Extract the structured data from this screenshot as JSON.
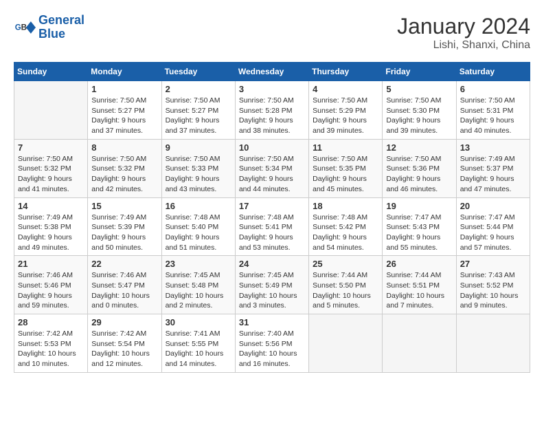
{
  "header": {
    "logo_line1": "General",
    "logo_line2": "Blue",
    "month": "January 2024",
    "location": "Lishi, Shanxi, China"
  },
  "weekdays": [
    "Sunday",
    "Monday",
    "Tuesday",
    "Wednesday",
    "Thursday",
    "Friday",
    "Saturday"
  ],
  "weeks": [
    [
      {
        "num": "",
        "info": ""
      },
      {
        "num": "1",
        "info": "Sunrise: 7:50 AM\nSunset: 5:27 PM\nDaylight: 9 hours\nand 37 minutes."
      },
      {
        "num": "2",
        "info": "Sunrise: 7:50 AM\nSunset: 5:27 PM\nDaylight: 9 hours\nand 37 minutes."
      },
      {
        "num": "3",
        "info": "Sunrise: 7:50 AM\nSunset: 5:28 PM\nDaylight: 9 hours\nand 38 minutes."
      },
      {
        "num": "4",
        "info": "Sunrise: 7:50 AM\nSunset: 5:29 PM\nDaylight: 9 hours\nand 39 minutes."
      },
      {
        "num": "5",
        "info": "Sunrise: 7:50 AM\nSunset: 5:30 PM\nDaylight: 9 hours\nand 39 minutes."
      },
      {
        "num": "6",
        "info": "Sunrise: 7:50 AM\nSunset: 5:31 PM\nDaylight: 9 hours\nand 40 minutes."
      }
    ],
    [
      {
        "num": "7",
        "info": "Sunrise: 7:50 AM\nSunset: 5:32 PM\nDaylight: 9 hours\nand 41 minutes."
      },
      {
        "num": "8",
        "info": "Sunrise: 7:50 AM\nSunset: 5:32 PM\nDaylight: 9 hours\nand 42 minutes."
      },
      {
        "num": "9",
        "info": "Sunrise: 7:50 AM\nSunset: 5:33 PM\nDaylight: 9 hours\nand 43 minutes."
      },
      {
        "num": "10",
        "info": "Sunrise: 7:50 AM\nSunset: 5:34 PM\nDaylight: 9 hours\nand 44 minutes."
      },
      {
        "num": "11",
        "info": "Sunrise: 7:50 AM\nSunset: 5:35 PM\nDaylight: 9 hours\nand 45 minutes."
      },
      {
        "num": "12",
        "info": "Sunrise: 7:50 AM\nSunset: 5:36 PM\nDaylight: 9 hours\nand 46 minutes."
      },
      {
        "num": "13",
        "info": "Sunrise: 7:49 AM\nSunset: 5:37 PM\nDaylight: 9 hours\nand 47 minutes."
      }
    ],
    [
      {
        "num": "14",
        "info": "Sunrise: 7:49 AM\nSunset: 5:38 PM\nDaylight: 9 hours\nand 49 minutes."
      },
      {
        "num": "15",
        "info": "Sunrise: 7:49 AM\nSunset: 5:39 PM\nDaylight: 9 hours\nand 50 minutes."
      },
      {
        "num": "16",
        "info": "Sunrise: 7:48 AM\nSunset: 5:40 PM\nDaylight: 9 hours\nand 51 minutes."
      },
      {
        "num": "17",
        "info": "Sunrise: 7:48 AM\nSunset: 5:41 PM\nDaylight: 9 hours\nand 53 minutes."
      },
      {
        "num": "18",
        "info": "Sunrise: 7:48 AM\nSunset: 5:42 PM\nDaylight: 9 hours\nand 54 minutes."
      },
      {
        "num": "19",
        "info": "Sunrise: 7:47 AM\nSunset: 5:43 PM\nDaylight: 9 hours\nand 55 minutes."
      },
      {
        "num": "20",
        "info": "Sunrise: 7:47 AM\nSunset: 5:44 PM\nDaylight: 9 hours\nand 57 minutes."
      }
    ],
    [
      {
        "num": "21",
        "info": "Sunrise: 7:46 AM\nSunset: 5:46 PM\nDaylight: 9 hours\nand 59 minutes."
      },
      {
        "num": "22",
        "info": "Sunrise: 7:46 AM\nSunset: 5:47 PM\nDaylight: 10 hours\nand 0 minutes."
      },
      {
        "num": "23",
        "info": "Sunrise: 7:45 AM\nSunset: 5:48 PM\nDaylight: 10 hours\nand 2 minutes."
      },
      {
        "num": "24",
        "info": "Sunrise: 7:45 AM\nSunset: 5:49 PM\nDaylight: 10 hours\nand 3 minutes."
      },
      {
        "num": "25",
        "info": "Sunrise: 7:44 AM\nSunset: 5:50 PM\nDaylight: 10 hours\nand 5 minutes."
      },
      {
        "num": "26",
        "info": "Sunrise: 7:44 AM\nSunset: 5:51 PM\nDaylight: 10 hours\nand 7 minutes."
      },
      {
        "num": "27",
        "info": "Sunrise: 7:43 AM\nSunset: 5:52 PM\nDaylight: 10 hours\nand 9 minutes."
      }
    ],
    [
      {
        "num": "28",
        "info": "Sunrise: 7:42 AM\nSunset: 5:53 PM\nDaylight: 10 hours\nand 10 minutes."
      },
      {
        "num": "29",
        "info": "Sunrise: 7:42 AM\nSunset: 5:54 PM\nDaylight: 10 hours\nand 12 minutes."
      },
      {
        "num": "30",
        "info": "Sunrise: 7:41 AM\nSunset: 5:55 PM\nDaylight: 10 hours\nand 14 minutes."
      },
      {
        "num": "31",
        "info": "Sunrise: 7:40 AM\nSunset: 5:56 PM\nDaylight: 10 hours\nand 16 minutes."
      },
      {
        "num": "",
        "info": ""
      },
      {
        "num": "",
        "info": ""
      },
      {
        "num": "",
        "info": ""
      }
    ]
  ]
}
